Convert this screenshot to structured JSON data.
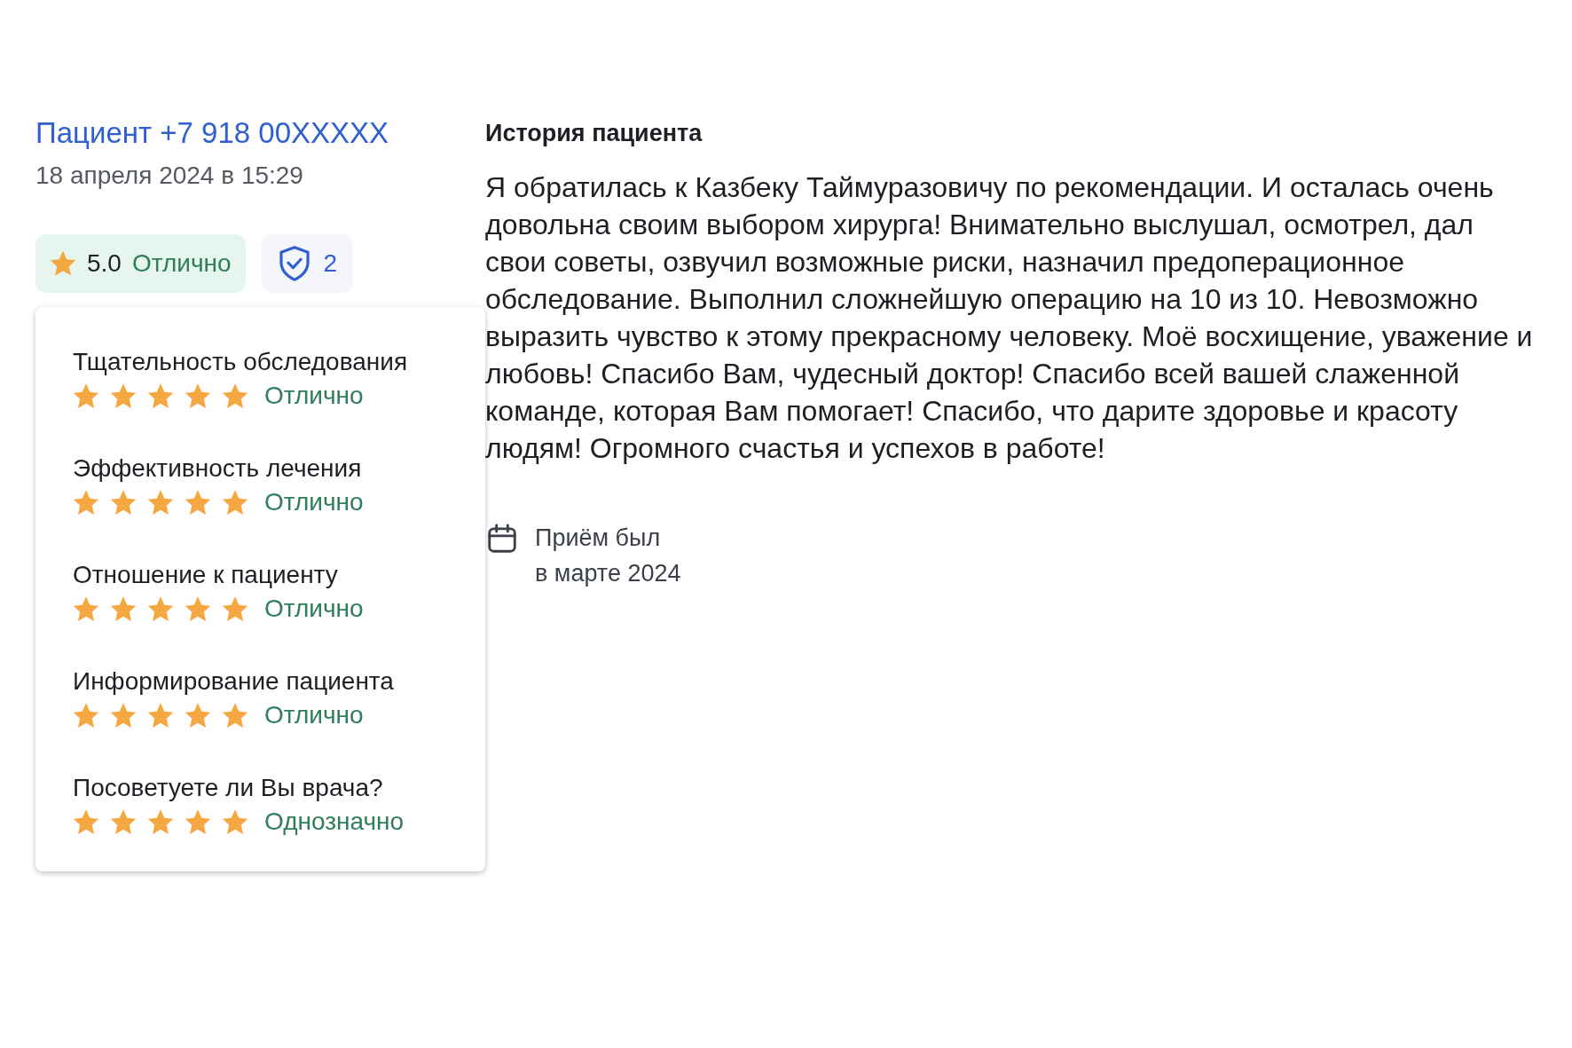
{
  "author": {
    "name": "Пациент +7 918 00XXXXX",
    "date": "18 апреля 2024 в 15:29"
  },
  "rating_badge": {
    "value": "5.0",
    "label": "Отлично"
  },
  "verified_badge": {
    "count": "2"
  },
  "criteria": [
    {
      "title": "Тщательность обследования",
      "stars": 5,
      "label": "Отлично"
    },
    {
      "title": "Эффективность лечения",
      "stars": 5,
      "label": "Отлично"
    },
    {
      "title": "Отношение к пациенту",
      "stars": 5,
      "label": "Отлично"
    },
    {
      "title": "Информирование пациента",
      "stars": 5,
      "label": "Отлично"
    },
    {
      "title": "Посоветуете ли Вы врача?",
      "stars": 5,
      "label": "Однозначно"
    }
  ],
  "story": {
    "heading": "История пациента",
    "text": "Я обратилась к Казбеку Таймуразовичу по рекомендации. И осталась очень довольна своим выбором хирурга! Внимательно выслушал, осмотрел, дал свои советы, озвучил возможные риски, назначил предоперационное обследование. Выполнил сложнейшую операцию на 10 из 10. Невозможно выразить чувство к этому прекрасному человеку. Моё восхищение, уважение и любовь! Спасибо Вам, чудесный доктор! Спасибо всей вашей слаженной команде, которая Вам помогает! Спасибо, что дарите здоровье и красоту людям! Огромного счастья и успехов в работе!"
  },
  "visit": {
    "lines": [
      "Приём был",
      "в марте 2024"
    ]
  }
}
